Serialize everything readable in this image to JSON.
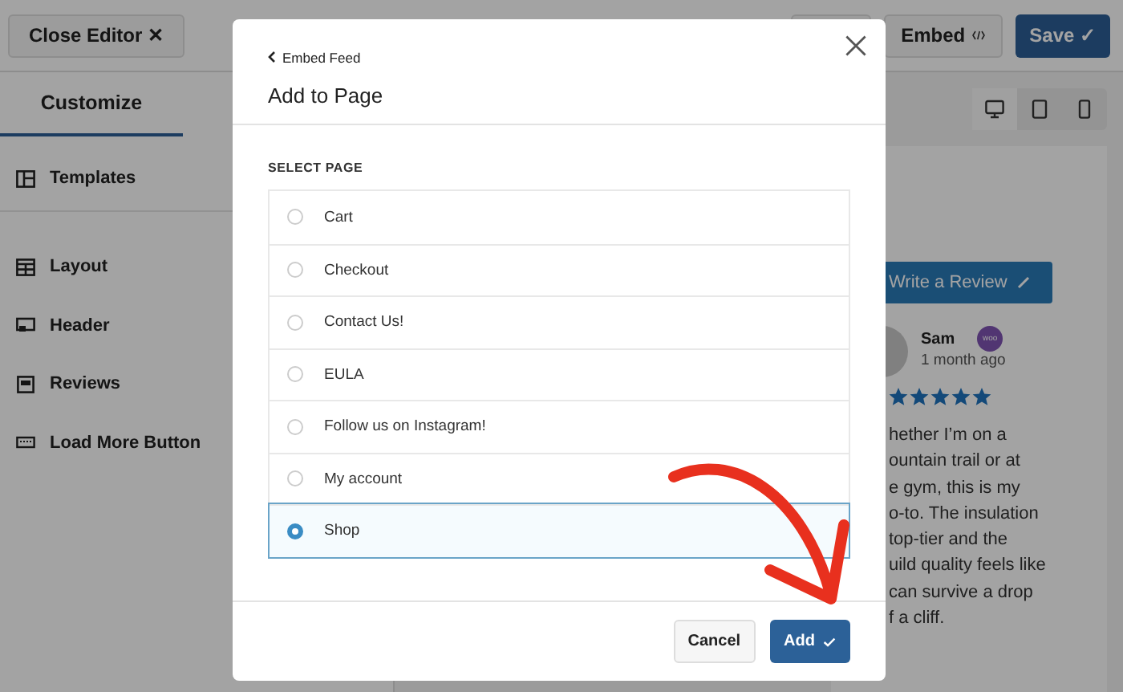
{
  "top_bar": {
    "close_button": "Close Editor ✕",
    "embed_button": "Embed",
    "save_button": "Save ✓"
  },
  "sidebar": {
    "tab": "Customize",
    "items": [
      {
        "label": "Templates",
        "kind": "templates"
      },
      {
        "label": "Layout",
        "kind": "layout"
      },
      {
        "label": "Header",
        "kind": "header"
      },
      {
        "label": "Reviews",
        "kind": "reviews"
      },
      {
        "label": "Load More Button",
        "kind": "loadmore"
      }
    ]
  },
  "devices": [
    {
      "kind": "desktop",
      "selected": true
    },
    {
      "kind": "tablet",
      "selected": false
    },
    {
      "kind": "phone",
      "selected": false
    }
  ],
  "preview": {
    "write_review": "Write a Review",
    "author": "Sam",
    "badge": "woo",
    "time": "1 month ago",
    "stars": 5,
    "text_lines": [
      "hether I’m on a",
      "ountain trail or at",
      "e gym, this is my",
      "o-to. The insulation",
      "top-tier and the",
      "uild quality feels like",
      "can survive a drop",
      "f a cliff."
    ]
  },
  "modal": {
    "back_link": "Embed Feed",
    "title": "Add to Page",
    "section_label": "SELECT PAGE",
    "pages": [
      {
        "label": "Cart",
        "selected": false
      },
      {
        "label": "Checkout",
        "selected": false
      },
      {
        "label": "Contact Us!",
        "selected": false
      },
      {
        "label": "EULA",
        "selected": false
      },
      {
        "label": "Follow us on Instagram!",
        "selected": false
      },
      {
        "label": "My account",
        "selected": false
      },
      {
        "label": "Shop",
        "selected": true
      }
    ],
    "cancel_button": "Cancel",
    "add_button": "Add"
  }
}
